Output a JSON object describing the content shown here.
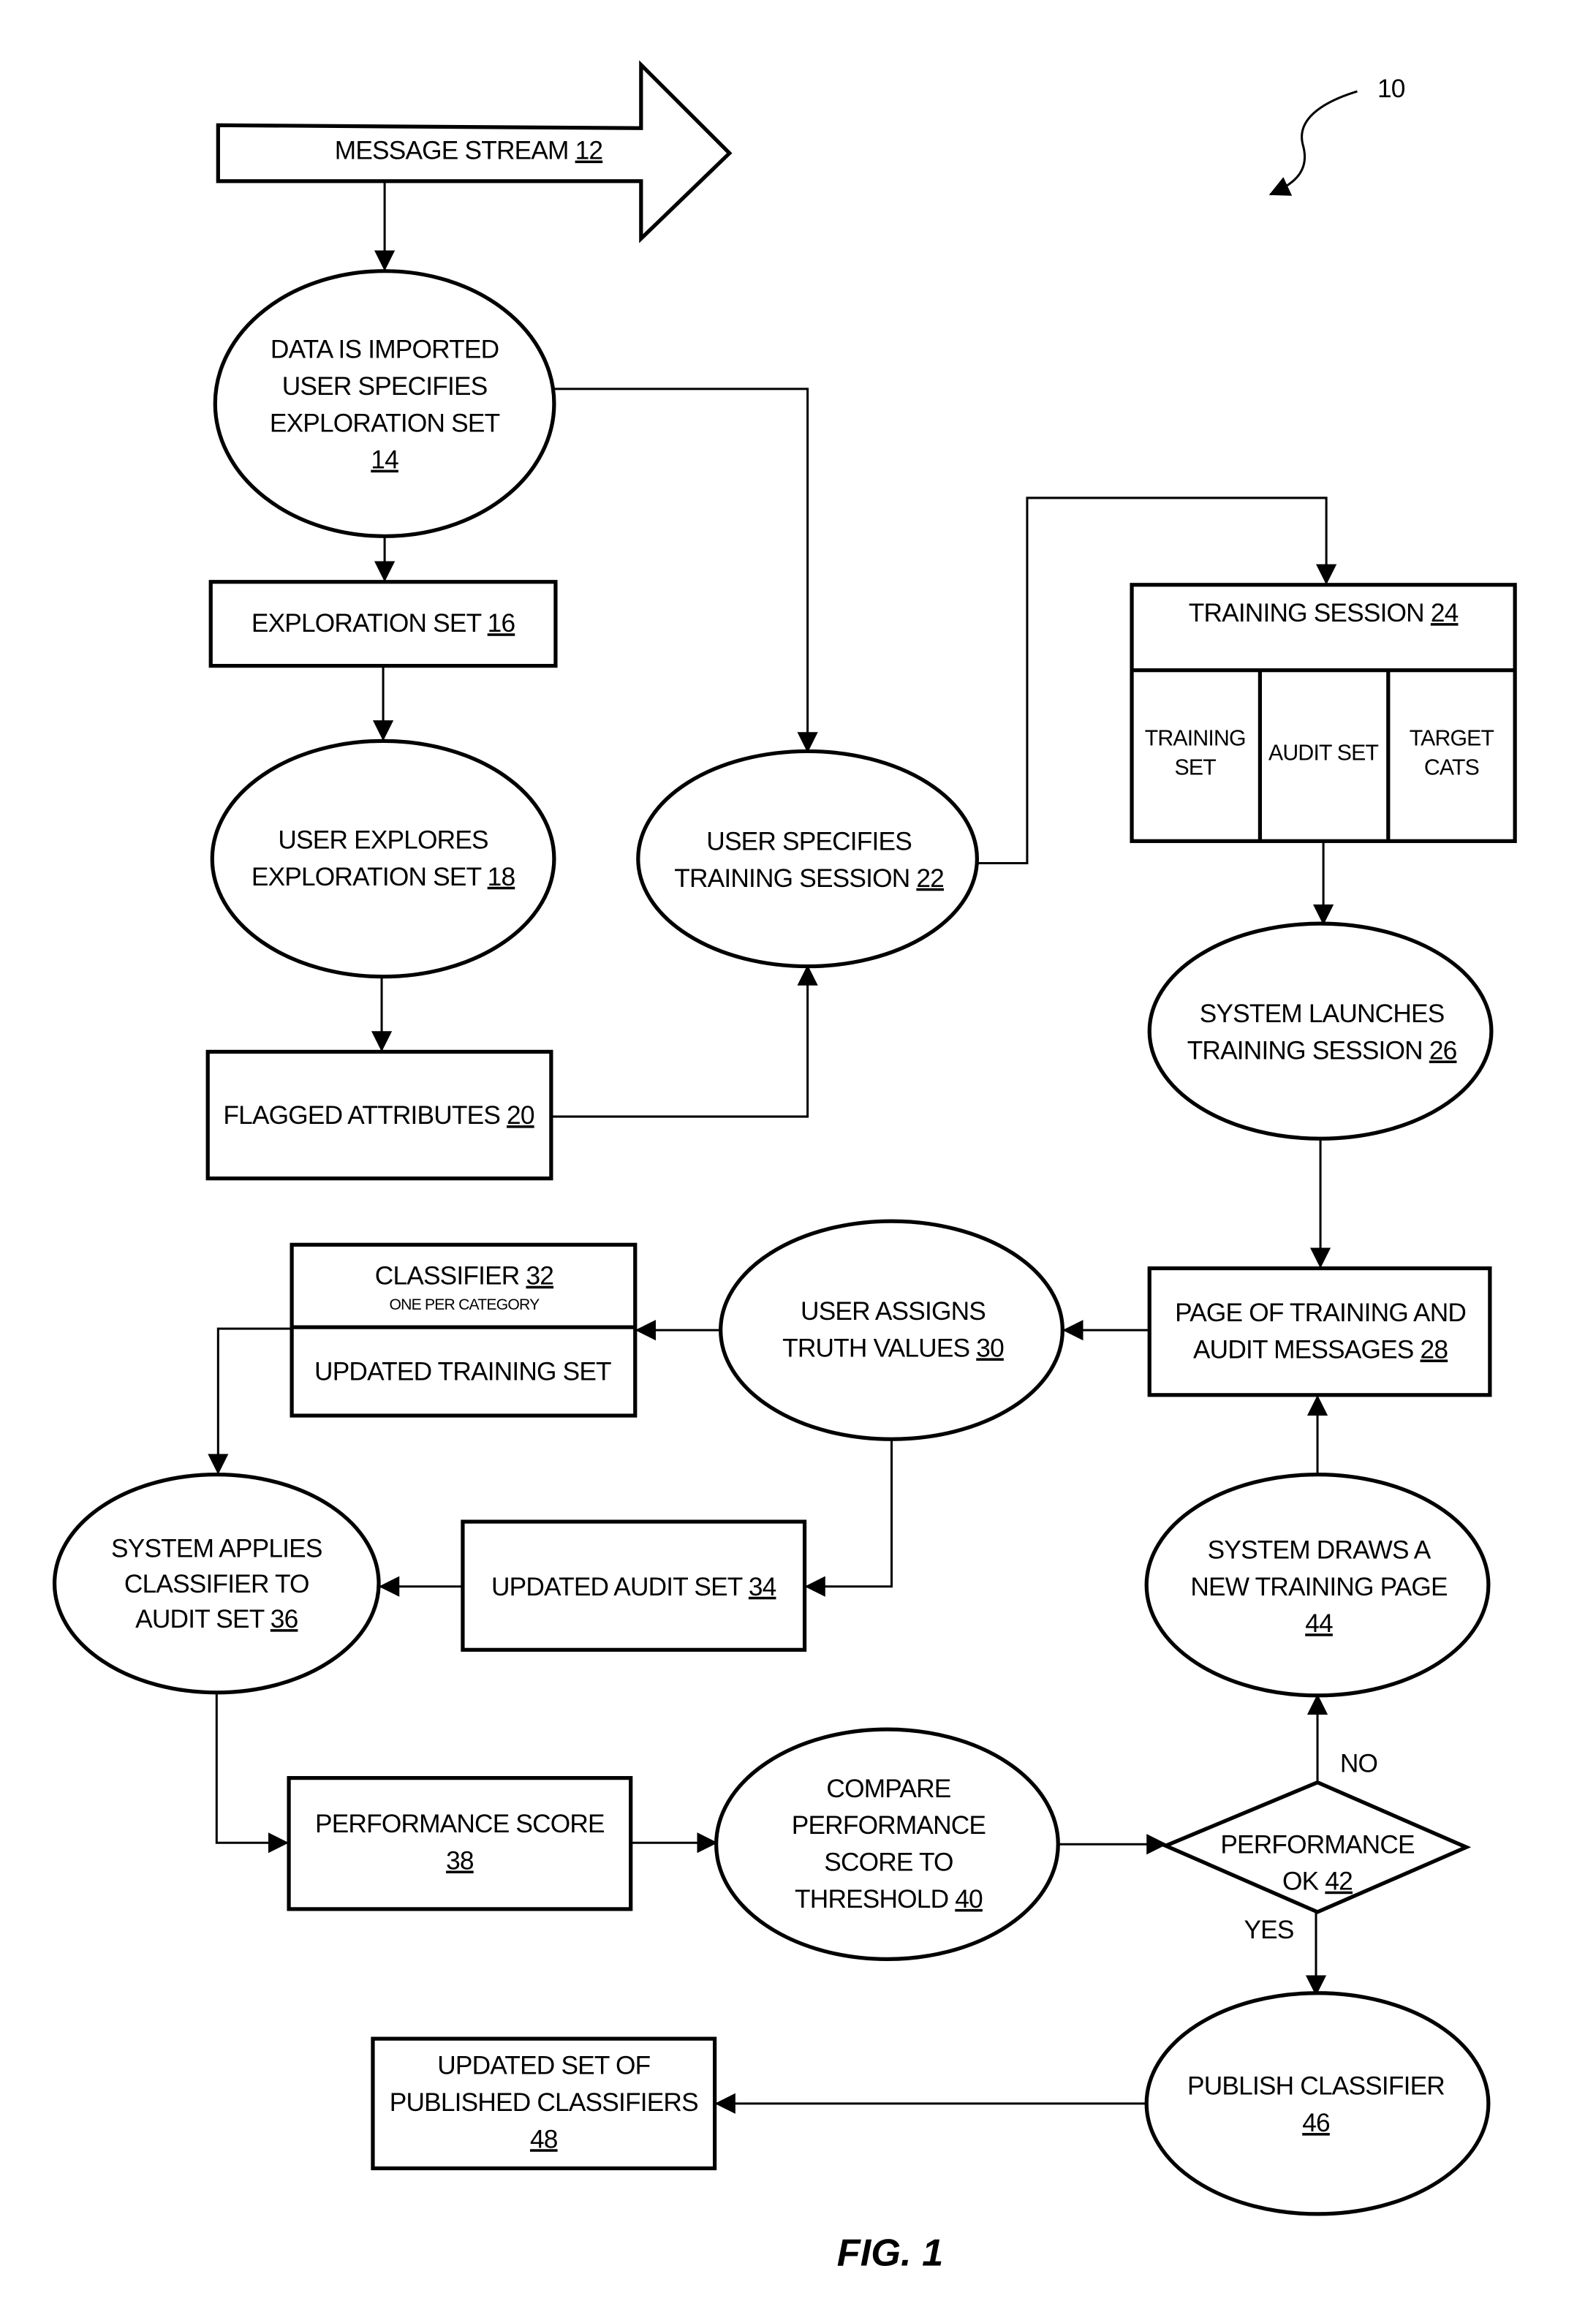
{
  "figure": {
    "reference_numeral": "10",
    "caption": "FIG. 1"
  },
  "nodes": {
    "message_stream": {
      "label": "MESSAGE STREAM ",
      "ref": "12",
      "shape": "block-arrow"
    },
    "data_imported": {
      "lines": [
        "DATA IS IMPORTED",
        "USER SPECIFIES",
        "EXPLORATION SET"
      ],
      "ref": "14",
      "shape": "ellipse"
    },
    "exploration_set": {
      "label": "EXPLORATION SET ",
      "ref": "16",
      "shape": "box"
    },
    "user_explores": {
      "lines": [
        "USER EXPLORES",
        "EXPLORATION SET "
      ],
      "ref": "18",
      "shape": "ellipse"
    },
    "flagged_attributes": {
      "label": "FLAGGED ATTRIBUTES ",
      "ref": "20",
      "shape": "box"
    },
    "user_specifies_training": {
      "lines": [
        "USER SPECIFIES",
        "TRAINING SESSION "
      ],
      "ref": "22",
      "shape": "ellipse"
    },
    "training_session": {
      "label": "TRAINING SESSION ",
      "ref": "24",
      "shape": "box",
      "columns": [
        {
          "lines": [
            "TRAINING",
            "SET"
          ]
        },
        {
          "lines": [
            "AUDIT SET"
          ]
        },
        {
          "lines": [
            "TARGET",
            "CATS"
          ]
        }
      ]
    },
    "system_launches": {
      "lines": [
        "SYSTEM LAUNCHES",
        "TRAINING SESSION "
      ],
      "ref": "26",
      "shape": "ellipse"
    },
    "page_of_training": {
      "lines": [
        "PAGE OF TRAINING AND",
        "AUDIT MESSAGES "
      ],
      "ref": "28",
      "shape": "box"
    },
    "user_assigns": {
      "lines": [
        "USER ASSIGNS",
        "TRUTH VALUES "
      ],
      "ref": "30",
      "shape": "ellipse"
    },
    "classifier": {
      "label": "CLASSIFIER ",
      "ref": "32",
      "sublabel": "ONE PER CATEGORY",
      "lower_label": "UPDATED TRAINING SET",
      "shape": "box"
    },
    "updated_audit_set": {
      "label": "UPDATED AUDIT SET ",
      "ref": "34",
      "shape": "box"
    },
    "system_applies": {
      "lines": [
        "SYSTEM APPLIES",
        "CLASSIFIER TO",
        "AUDIT SET "
      ],
      "ref": "36",
      "shape": "ellipse"
    },
    "performance_score": {
      "lines": [
        "PERFORMANCE SCORE"
      ],
      "ref": "38",
      "shape": "box"
    },
    "compare_performance": {
      "lines": [
        "COMPARE",
        "PERFORMANCE",
        "SCORE TO",
        "THRESHOLD "
      ],
      "ref": "40",
      "shape": "ellipse"
    },
    "performance_ok": {
      "lines": [
        "PERFORMANCE",
        "OK "
      ],
      "ref": "42",
      "shape": "diamond",
      "no_label": "NO",
      "yes_label": "YES"
    },
    "system_draws": {
      "lines": [
        "SYSTEM DRAWS A",
        "NEW TRAINING PAGE"
      ],
      "ref": "44",
      "shape": "ellipse"
    },
    "publish_classifier": {
      "lines": [
        "PUBLISH CLASSIFIER"
      ],
      "ref": "46",
      "shape": "ellipse"
    },
    "published_classifiers": {
      "lines": [
        "UPDATED SET OF",
        "PUBLISHED CLASSIFIERS"
      ],
      "ref": "48",
      "shape": "box"
    }
  }
}
